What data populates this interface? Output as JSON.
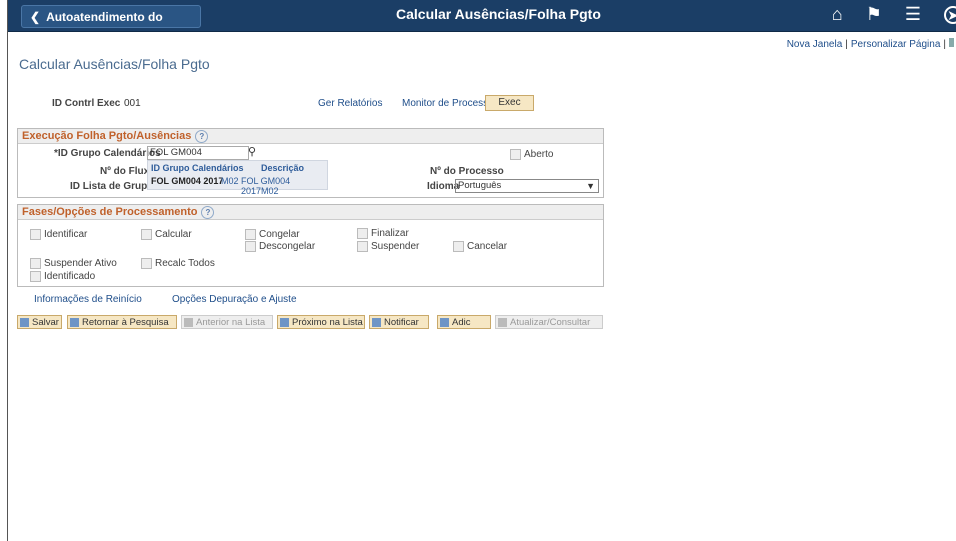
{
  "topbar": {
    "back_label": "Autoatendimento do Gerente",
    "title": "Calcular Ausências/Folha Pgto",
    "icons": [
      "home-icon",
      "flag-icon",
      "menu-icon",
      "nav-icon"
    ]
  },
  "links": {
    "new_window": "Nova Janela",
    "personalize": "Personalizar Página",
    "sep": "|"
  },
  "page_title": "Calcular Ausências/Folha Pgto",
  "run_control": {
    "label": "ID Contrl Exec",
    "value": "001"
  },
  "actions": {
    "reports": "Ger Relatórios",
    "monitor": "Monitor de Processos",
    "exec": "Exec"
  },
  "section1": {
    "title": "Execução Folha Pgto/Ausências",
    "cal_group_label": "*ID Grupo Calendários",
    "cal_group_value": "FOL GM004 2017M02",
    "aberto_label": "Aberto",
    "fluxo_label": "Nº do Fluxo",
    "processo_label": "Nº do Processo",
    "lista_label": "ID Lista de Grupos",
    "idioma_label": "Idioma",
    "idioma_value": "Português",
    "dropdown": {
      "col1": "ID Grupo Calendários",
      "col2": "Descrição",
      "row_bold": "FOL GM004 2017",
      "row_rest": "M02",
      "row_desc": "FOL GM004 2017M02"
    }
  },
  "section2": {
    "title": "Fases/Opções de Processamento",
    "options": {
      "identificar": "Identificar",
      "calcular": "Calcular",
      "congelar": "Congelar",
      "finalizar": "Finalizar",
      "descongelar": "Descongelar",
      "suspender": "Suspender",
      "cancelar": "Cancelar",
      "suspender_ativo": "Suspender Ativo",
      "recalc_todos": "Recalc Todos",
      "identificado": "Identificado"
    }
  },
  "bottom_links": {
    "restart": "Informações de Reinício",
    "debug": "Opções Depuração e Ajuste"
  },
  "toolbar": {
    "save": "Salvar",
    "return": "Retornar à Pesquisa",
    "prev": "Anterior na Lista",
    "next": "Próximo na Lista",
    "notify": "Notificar",
    "add": "Adic",
    "update": "Atualizar/Consultar"
  }
}
